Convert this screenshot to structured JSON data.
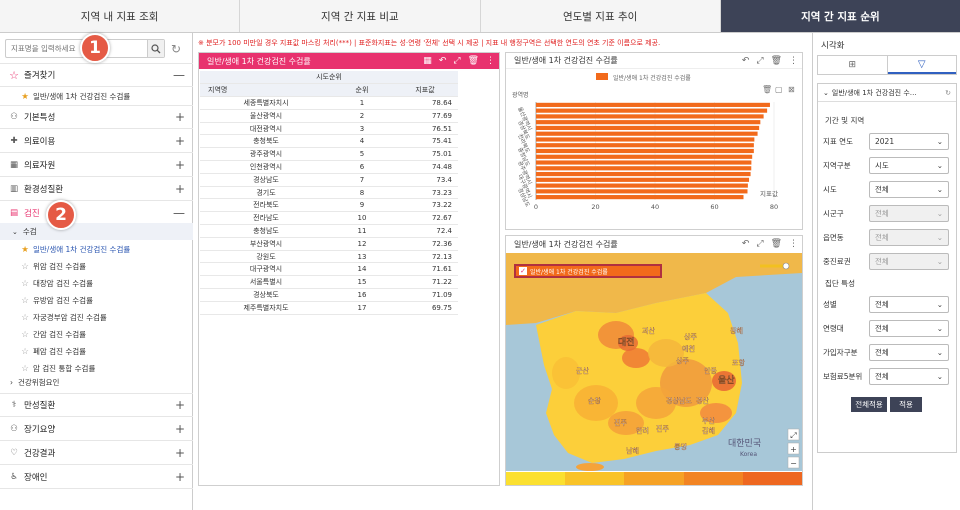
{
  "tabs": [
    "지역 내 지표 조회",
    "지역 간 지표 비교",
    "연도별 지표 추이",
    "지역 간 지표 순위"
  ],
  "search": {
    "placeholder": "지표명을 입력하세요"
  },
  "badges": [
    "1",
    "2"
  ],
  "favorites": {
    "label": "즐겨찾기",
    "item": "일반/생애 1차 건강검진 수검률"
  },
  "categories": [
    "기본특성",
    "의료이용",
    "의료자원",
    "환경성질환",
    "검진"
  ],
  "active_group": "수검",
  "sub_items": [
    "일반/생애 1차 건강검진 수검률",
    "위암 검진 수검률",
    "대장암 검진 수검률",
    "유방암 검진 수검률",
    "자궁경부암 검진 수검률",
    "간암 검진 수검률",
    "폐암 검진 수검률",
    "암 검진 통합 수검률"
  ],
  "sub_more": "건강위험요인",
  "categories2": [
    "만성질환",
    "장기요양",
    "건강결과",
    "장애인"
  ],
  "notice": "※ 분모가 100 미만일 경우 지표값 마스킹 처리(***) | 표준화지표는 성·연령 '전체' 선택 시 제공 | 지표 내 행정구역은 선택한 연도의 연초 기준 이름으로 제공.",
  "table_panel": {
    "title": "일반/생애 1차 건강검진 수검률",
    "group_header": "시도순위",
    "cols": [
      "지역명",
      "순위",
      "지표값"
    ],
    "rows": [
      [
        "세종특별자치시",
        "1",
        "78.64"
      ],
      [
        "울산광역시",
        "2",
        "77.69"
      ],
      [
        "대전광역시",
        "3",
        "76.51"
      ],
      [
        "충청북도",
        "4",
        "75.41"
      ],
      [
        "광주광역시",
        "5",
        "75.01"
      ],
      [
        "인천광역시",
        "6",
        "74.48"
      ],
      [
        "경상남도",
        "7",
        "73.4"
      ],
      [
        "경기도",
        "8",
        "73.23"
      ],
      [
        "전라북도",
        "9",
        "73.22"
      ],
      [
        "전라남도",
        "10",
        "72.67"
      ],
      [
        "충청남도",
        "11",
        "72.4"
      ],
      [
        "부산광역시",
        "12",
        "72.36"
      ],
      [
        "강원도",
        "13",
        "72.13"
      ],
      [
        "대구광역시",
        "14",
        "71.61"
      ],
      [
        "서울특별시",
        "15",
        "71.22"
      ],
      [
        "경상북도",
        "16",
        "71.09"
      ],
      [
        "제주특별자치도",
        "17",
        "69.75"
      ]
    ]
  },
  "chart_panel": {
    "title": "일반/생애 1차 건강검진 수검률",
    "ylabel": "광역명",
    "xlabel": "지표값"
  },
  "chart_data": {
    "type": "bar",
    "orientation": "horizontal",
    "title": "",
    "legend": "일반/생애 1차 건강검진 수검률",
    "ylabel": "광역명",
    "xlabel": "지표값",
    "xlim": [
      0,
      80
    ],
    "xticks": [
      "0",
      "20",
      "40",
      "60",
      "80"
    ],
    "categories": [
      "세종특별자치시",
      "울산광역시",
      "대전광역시",
      "충청북도",
      "광주광역시",
      "인천광역시",
      "경상남도",
      "경기도",
      "전라북도",
      "전라남도",
      "충청남도",
      "부산광역시",
      "강원도",
      "대구광역시",
      "서울특별시",
      "경상북도",
      "제주특별자치도"
    ],
    "values": [
      78.64,
      77.69,
      76.51,
      75.41,
      75.01,
      74.48,
      73.4,
      73.23,
      73.22,
      72.67,
      72.4,
      72.36,
      72.13,
      71.61,
      71.22,
      71.09,
      69.75
    ],
    "y_tick_labels": [
      "울산광역시",
      "경상북도",
      "전라북도",
      "충청남도",
      "광주광역시",
      "대구광역시",
      "경상남도"
    ],
    "bar_color": "#f26a1b"
  },
  "map_panel": {
    "title": "일반/생애 1차 건강검진 수검률",
    "legend": "일반/생애 1차 건강검진 수검률",
    "labels": [
      "대전",
      "울산",
      "부산",
      "군산",
      "순창",
      "상주",
      "안동",
      "포항",
      "예천",
      "한려",
      "동해",
      "김해",
      "통영",
      "남해",
      "진주",
      "진주",
      "상주",
      "괴산",
      "경상남도",
      "경산"
    ],
    "sea_label": "대한민국",
    "sea_sub": "Korea"
  },
  "map_scale_colors": [
    "#fbe030",
    "#f9c328",
    "#f6a225",
    "#f28423",
    "#ee6720"
  ],
  "right": {
    "title": "시각화",
    "vtabs": [
      "BB",
      "▽"
    ],
    "indicator": "일반/생애 1차 건강검진 수…",
    "sec1": "기간 및 지역",
    "sec2": "집단 특성",
    "filters1": [
      [
        "지표 연도",
        "2021",
        false
      ],
      [
        "지역구분",
        "시도",
        false
      ],
      [
        "시도",
        "전체",
        false
      ],
      [
        "시군구",
        "전체",
        true
      ],
      [
        "읍면동",
        "전체",
        true
      ],
      [
        "중진료권",
        "전체",
        true
      ]
    ],
    "filters2": [
      [
        "성별",
        "전체",
        false
      ],
      [
        "연령대",
        "전체",
        false
      ],
      [
        "가입자구분",
        "전체",
        false
      ],
      [
        "보험료5분위",
        "전체",
        false
      ]
    ],
    "apply_all": "전체적용",
    "apply": "적용"
  },
  "colors": {
    "accent": "#e8326e",
    "header_dark": "#3d4357",
    "badge": "#e55a45",
    "favorite": "#e8a020"
  }
}
